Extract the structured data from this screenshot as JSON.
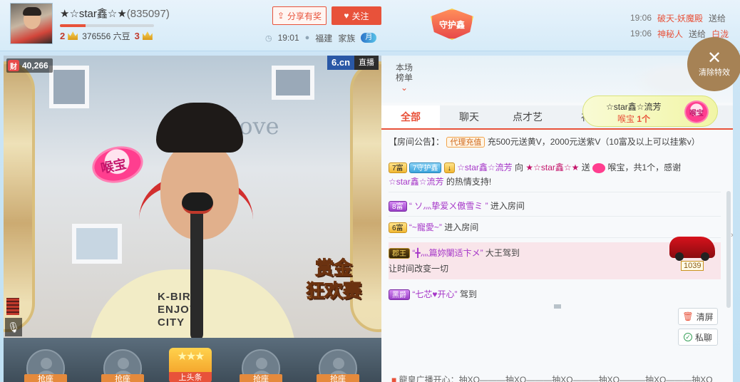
{
  "header": {
    "host_name": "★☆star鑫☆★",
    "host_id": "(835097)",
    "level_progress": 0.27,
    "level_left": "2",
    "level_right": "3",
    "beans_count": "376556",
    "beans_unit": "六豆",
    "share_label": "分享有奖",
    "follow_label": "关注",
    "time": "19:01",
    "location": "福建",
    "family_label": "家族",
    "family_badge": "月",
    "guard_label": "守护鑫"
  },
  "feed": [
    {
      "time": "19:06",
      "name": "破天-妖魔殿",
      "action": "送给"
    },
    {
      "time": "19:06",
      "name": "神秘人",
      "action": "送给",
      "target": "白泷"
    }
  ],
  "clear_fx_label": "清除特效",
  "video": {
    "hotness": "40,266",
    "hotness_icon": "财",
    "site_logo": "6.cn",
    "live_label": "直播",
    "houbao_text": "喉宝",
    "reward_line1": "赏金",
    "reward_line2": "狂欢赛",
    "wall_word": "love",
    "shirt_line1": "K-BIRD",
    "shirt_line2": "ENJOY",
    "shirt_line3": "CITY"
  },
  "seats": {
    "seat_label": "抢座",
    "top_label": "上头条"
  },
  "panel": {
    "rank_label_1": "本场",
    "rank_label_2": "榜单",
    "tabs": [
      "全部",
      "聊天",
      "点才艺",
      "礼"
    ],
    "gift_toast": {
      "who": "☆star鑫☆流芳",
      "gift": "喉宝",
      "count": "1个",
      "icon_text": "喉宝"
    },
    "notice": {
      "label": "【房间公告】：",
      "tag": "代理充值",
      "text": "充500元送黄V，2000元送紫V（10富及以上可以挂紫v）"
    },
    "chat": [
      {
        "badge1": "7富",
        "badge2": "7守护鑫",
        "badge3": "↓",
        "from": "☆star鑫☆流芳",
        "mid": "向",
        "to": "★☆star鑫☆★",
        "verb": "送",
        "gift": "喉宝，共1个，感谢",
        "line2_name": "☆star鑫☆流芳",
        "line2_text": "的热情支持!"
      },
      {
        "badge": "8富",
        "name": "“ ソ灬挚爱ㄨ傲雪ミ ”",
        "text": "进入房间"
      },
      {
        "badge": "6富",
        "name": "“~寵愛~”",
        "text": "进入房间"
      },
      {
        "badge": "郡王",
        "name": "“╋灬篇妳闌适卞メ”",
        "text": "大王驾到",
        "line2": "让时间改变一切",
        "car_number": "1039"
      },
      {
        "badge": "黑爵",
        "name": "“七芯♥开心”",
        "text": "驾到"
      }
    ],
    "clear_screen_label": "清屏",
    "private_chat_label": "私聊",
    "broadcast": "龍皇广播开心：抽XO———抽XO———抽XO———抽XO———抽XO———抽XO"
  },
  "colors": {
    "accent": "#e8523a",
    "header_bg": "#d6ebf8",
    "purple_name": "#a637c8"
  }
}
